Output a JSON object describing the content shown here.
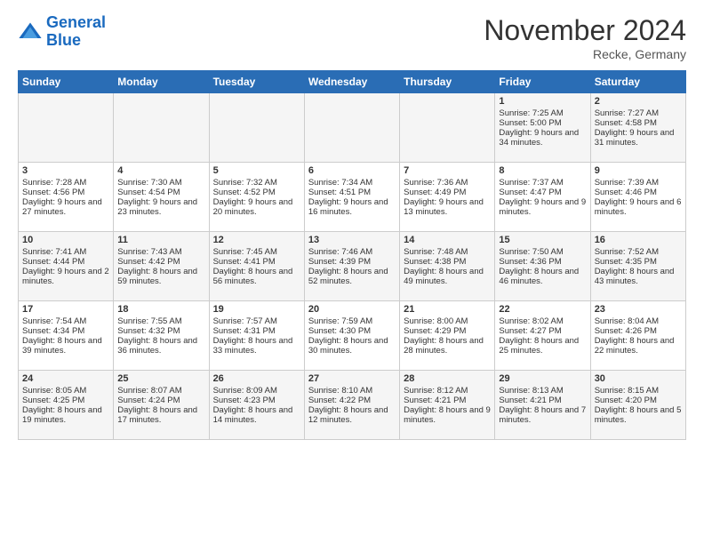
{
  "header": {
    "logo_line1": "General",
    "logo_line2": "Blue",
    "title": "November 2024",
    "subtitle": "Recke, Germany"
  },
  "columns": [
    "Sunday",
    "Monday",
    "Tuesday",
    "Wednesday",
    "Thursday",
    "Friday",
    "Saturday"
  ],
  "weeks": [
    [
      {
        "day": "",
        "info": ""
      },
      {
        "day": "",
        "info": ""
      },
      {
        "day": "",
        "info": ""
      },
      {
        "day": "",
        "info": ""
      },
      {
        "day": "",
        "info": ""
      },
      {
        "day": "1",
        "info": "Sunrise: 7:25 AM\nSunset: 5:00 PM\nDaylight: 9 hours and 34 minutes."
      },
      {
        "day": "2",
        "info": "Sunrise: 7:27 AM\nSunset: 4:58 PM\nDaylight: 9 hours and 31 minutes."
      }
    ],
    [
      {
        "day": "3",
        "info": "Sunrise: 7:28 AM\nSunset: 4:56 PM\nDaylight: 9 hours and 27 minutes."
      },
      {
        "day": "4",
        "info": "Sunrise: 7:30 AM\nSunset: 4:54 PM\nDaylight: 9 hours and 23 minutes."
      },
      {
        "day": "5",
        "info": "Sunrise: 7:32 AM\nSunset: 4:52 PM\nDaylight: 9 hours and 20 minutes."
      },
      {
        "day": "6",
        "info": "Sunrise: 7:34 AM\nSunset: 4:51 PM\nDaylight: 9 hours and 16 minutes."
      },
      {
        "day": "7",
        "info": "Sunrise: 7:36 AM\nSunset: 4:49 PM\nDaylight: 9 hours and 13 minutes."
      },
      {
        "day": "8",
        "info": "Sunrise: 7:37 AM\nSunset: 4:47 PM\nDaylight: 9 hours and 9 minutes."
      },
      {
        "day": "9",
        "info": "Sunrise: 7:39 AM\nSunset: 4:46 PM\nDaylight: 9 hours and 6 minutes."
      }
    ],
    [
      {
        "day": "10",
        "info": "Sunrise: 7:41 AM\nSunset: 4:44 PM\nDaylight: 9 hours and 2 minutes."
      },
      {
        "day": "11",
        "info": "Sunrise: 7:43 AM\nSunset: 4:42 PM\nDaylight: 8 hours and 59 minutes."
      },
      {
        "day": "12",
        "info": "Sunrise: 7:45 AM\nSunset: 4:41 PM\nDaylight: 8 hours and 56 minutes."
      },
      {
        "day": "13",
        "info": "Sunrise: 7:46 AM\nSunset: 4:39 PM\nDaylight: 8 hours and 52 minutes."
      },
      {
        "day": "14",
        "info": "Sunrise: 7:48 AM\nSunset: 4:38 PM\nDaylight: 8 hours and 49 minutes."
      },
      {
        "day": "15",
        "info": "Sunrise: 7:50 AM\nSunset: 4:36 PM\nDaylight: 8 hours and 46 minutes."
      },
      {
        "day": "16",
        "info": "Sunrise: 7:52 AM\nSunset: 4:35 PM\nDaylight: 8 hours and 43 minutes."
      }
    ],
    [
      {
        "day": "17",
        "info": "Sunrise: 7:54 AM\nSunset: 4:34 PM\nDaylight: 8 hours and 39 minutes."
      },
      {
        "day": "18",
        "info": "Sunrise: 7:55 AM\nSunset: 4:32 PM\nDaylight: 8 hours and 36 minutes."
      },
      {
        "day": "19",
        "info": "Sunrise: 7:57 AM\nSunset: 4:31 PM\nDaylight: 8 hours and 33 minutes."
      },
      {
        "day": "20",
        "info": "Sunrise: 7:59 AM\nSunset: 4:30 PM\nDaylight: 8 hours and 30 minutes."
      },
      {
        "day": "21",
        "info": "Sunrise: 8:00 AM\nSunset: 4:29 PM\nDaylight: 8 hours and 28 minutes."
      },
      {
        "day": "22",
        "info": "Sunrise: 8:02 AM\nSunset: 4:27 PM\nDaylight: 8 hours and 25 minutes."
      },
      {
        "day": "23",
        "info": "Sunrise: 8:04 AM\nSunset: 4:26 PM\nDaylight: 8 hours and 22 minutes."
      }
    ],
    [
      {
        "day": "24",
        "info": "Sunrise: 8:05 AM\nSunset: 4:25 PM\nDaylight: 8 hours and 19 minutes."
      },
      {
        "day": "25",
        "info": "Sunrise: 8:07 AM\nSunset: 4:24 PM\nDaylight: 8 hours and 17 minutes."
      },
      {
        "day": "26",
        "info": "Sunrise: 8:09 AM\nSunset: 4:23 PM\nDaylight: 8 hours and 14 minutes."
      },
      {
        "day": "27",
        "info": "Sunrise: 8:10 AM\nSunset: 4:22 PM\nDaylight: 8 hours and 12 minutes."
      },
      {
        "day": "28",
        "info": "Sunrise: 8:12 AM\nSunset: 4:21 PM\nDaylight: 8 hours and 9 minutes."
      },
      {
        "day": "29",
        "info": "Sunrise: 8:13 AM\nSunset: 4:21 PM\nDaylight: 8 hours and 7 minutes."
      },
      {
        "day": "30",
        "info": "Sunrise: 8:15 AM\nSunset: 4:20 PM\nDaylight: 8 hours and 5 minutes."
      }
    ]
  ]
}
